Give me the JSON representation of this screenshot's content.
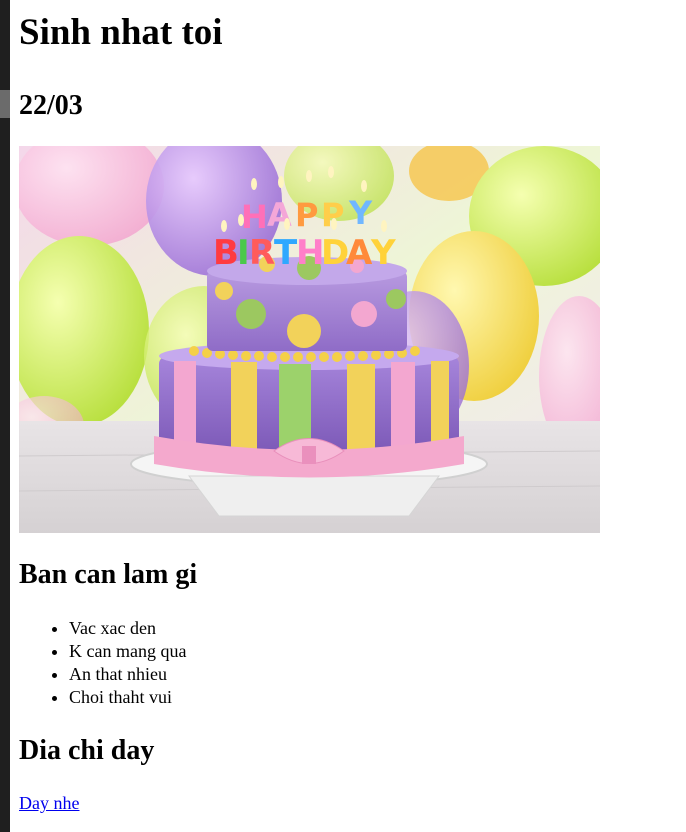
{
  "page": {
    "title": "Sinh nhat toi",
    "date": "22/03"
  },
  "image": {
    "cake_text_top": "HAPPY",
    "cake_text_bottom": "BIRTHDAY"
  },
  "todo": {
    "heading": "Ban can lam gi",
    "items": [
      "Vac xac den",
      "K can mang qua",
      "An that nhieu",
      "Choi thaht vui"
    ]
  },
  "address": {
    "heading": "Dia chi day",
    "link_text": "Day nhe"
  },
  "colors": {
    "link": "#0000ee",
    "text": "#000000",
    "background": "#ffffff",
    "left_bar": "#1f1f1f"
  }
}
